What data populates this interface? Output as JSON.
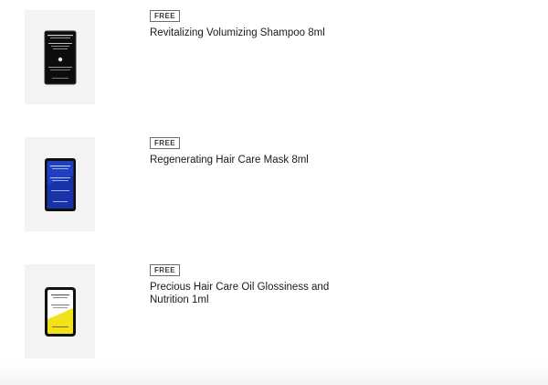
{
  "items": [
    {
      "badge": "FREE",
      "name": "Revitalizing Volumizing Shampoo 8ml",
      "image_icon": "product-sachet-black",
      "sachet_color": "#111111"
    },
    {
      "badge": "FREE",
      "name": "Regenerating Hair Care Mask 8ml",
      "image_icon": "product-sachet-blue",
      "sachet_color": "#1f3ec2"
    },
    {
      "badge": "FREE",
      "name": "Precious Hair Care Oil Glossiness and Nutrition 1ml",
      "image_icon": "product-sachet-yellow",
      "sachet_color": "#f2e21c"
    }
  ]
}
